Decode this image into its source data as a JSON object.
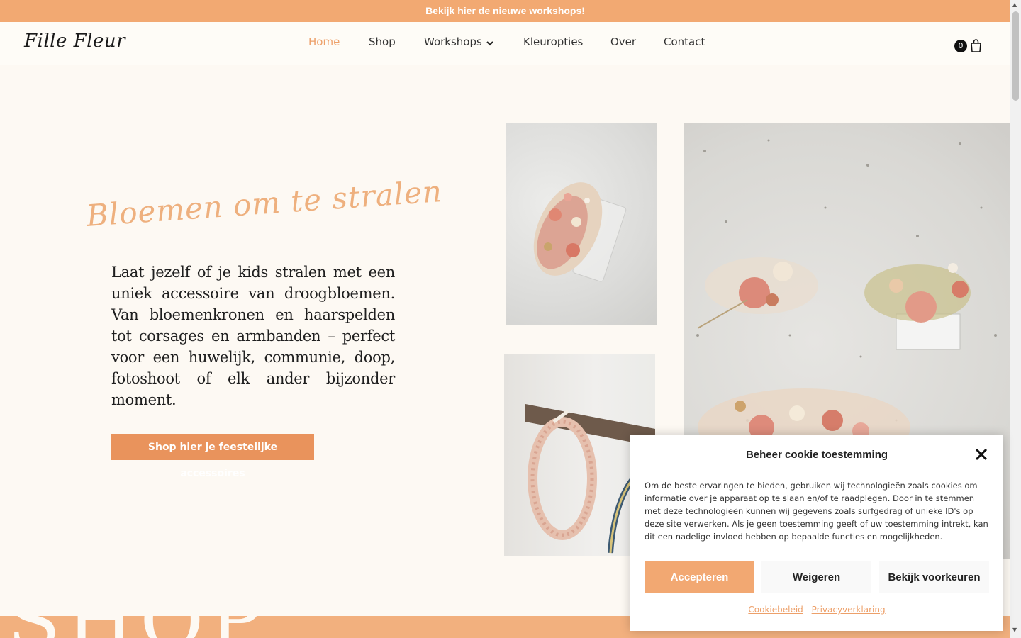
{
  "announcement": {
    "text": "Bekijk hier de nieuwe workshops!"
  },
  "header": {
    "logo": "Fille Fleur",
    "nav": [
      {
        "label": "Home",
        "active": true
      },
      {
        "label": "Shop"
      },
      {
        "label": "Workshops",
        "has_dropdown": true
      },
      {
        "label": "Kleuropties"
      },
      {
        "label": "Over"
      },
      {
        "label": "Contact"
      }
    ],
    "cart": {
      "count": "0",
      "icon": "shopping-bag-icon"
    }
  },
  "hero": {
    "script_title": "Bloemen om te stralen",
    "text": "Laat jezelf of je kids stralen met een uniek accessoire van droogbloemen. Van bloemenkronen en haarspelden tot corsages en armbanden – perfect voor een huwelijk, communie, doop, fotoshoot of elk ander bijzonder moment.",
    "button_label": "Shop hier je feestelijke accessoires"
  },
  "bottom_section": {
    "heading": "SHOP"
  },
  "cookie_modal": {
    "title": "Beheer cookie toestemming",
    "text": "Om de beste ervaringen te bieden, gebruiken wij technologieën zoals cookies om informatie over je apparaat op te slaan en/of te raadplegen. Door in te stemmen met deze technologieën kunnen wij gegevens zoals surfgedrag of unieke ID's op deze site verwerken. Als je geen toestemming geeft of uw toestemming intrekt, kan dit een nadelige invloed hebben op bepaalde functies en mogelijkheden.",
    "accept_label": "Accepteren",
    "deny_label": "Weigeren",
    "prefs_label": "Bekijk voorkeuren",
    "links": [
      "Cookiebeleid",
      "Privacyverklaring"
    ]
  },
  "colors": {
    "accent": "#f2a972",
    "accent_dark": "#e9935c",
    "background": "#fdf9f3",
    "active_nav": "#eda06a"
  }
}
